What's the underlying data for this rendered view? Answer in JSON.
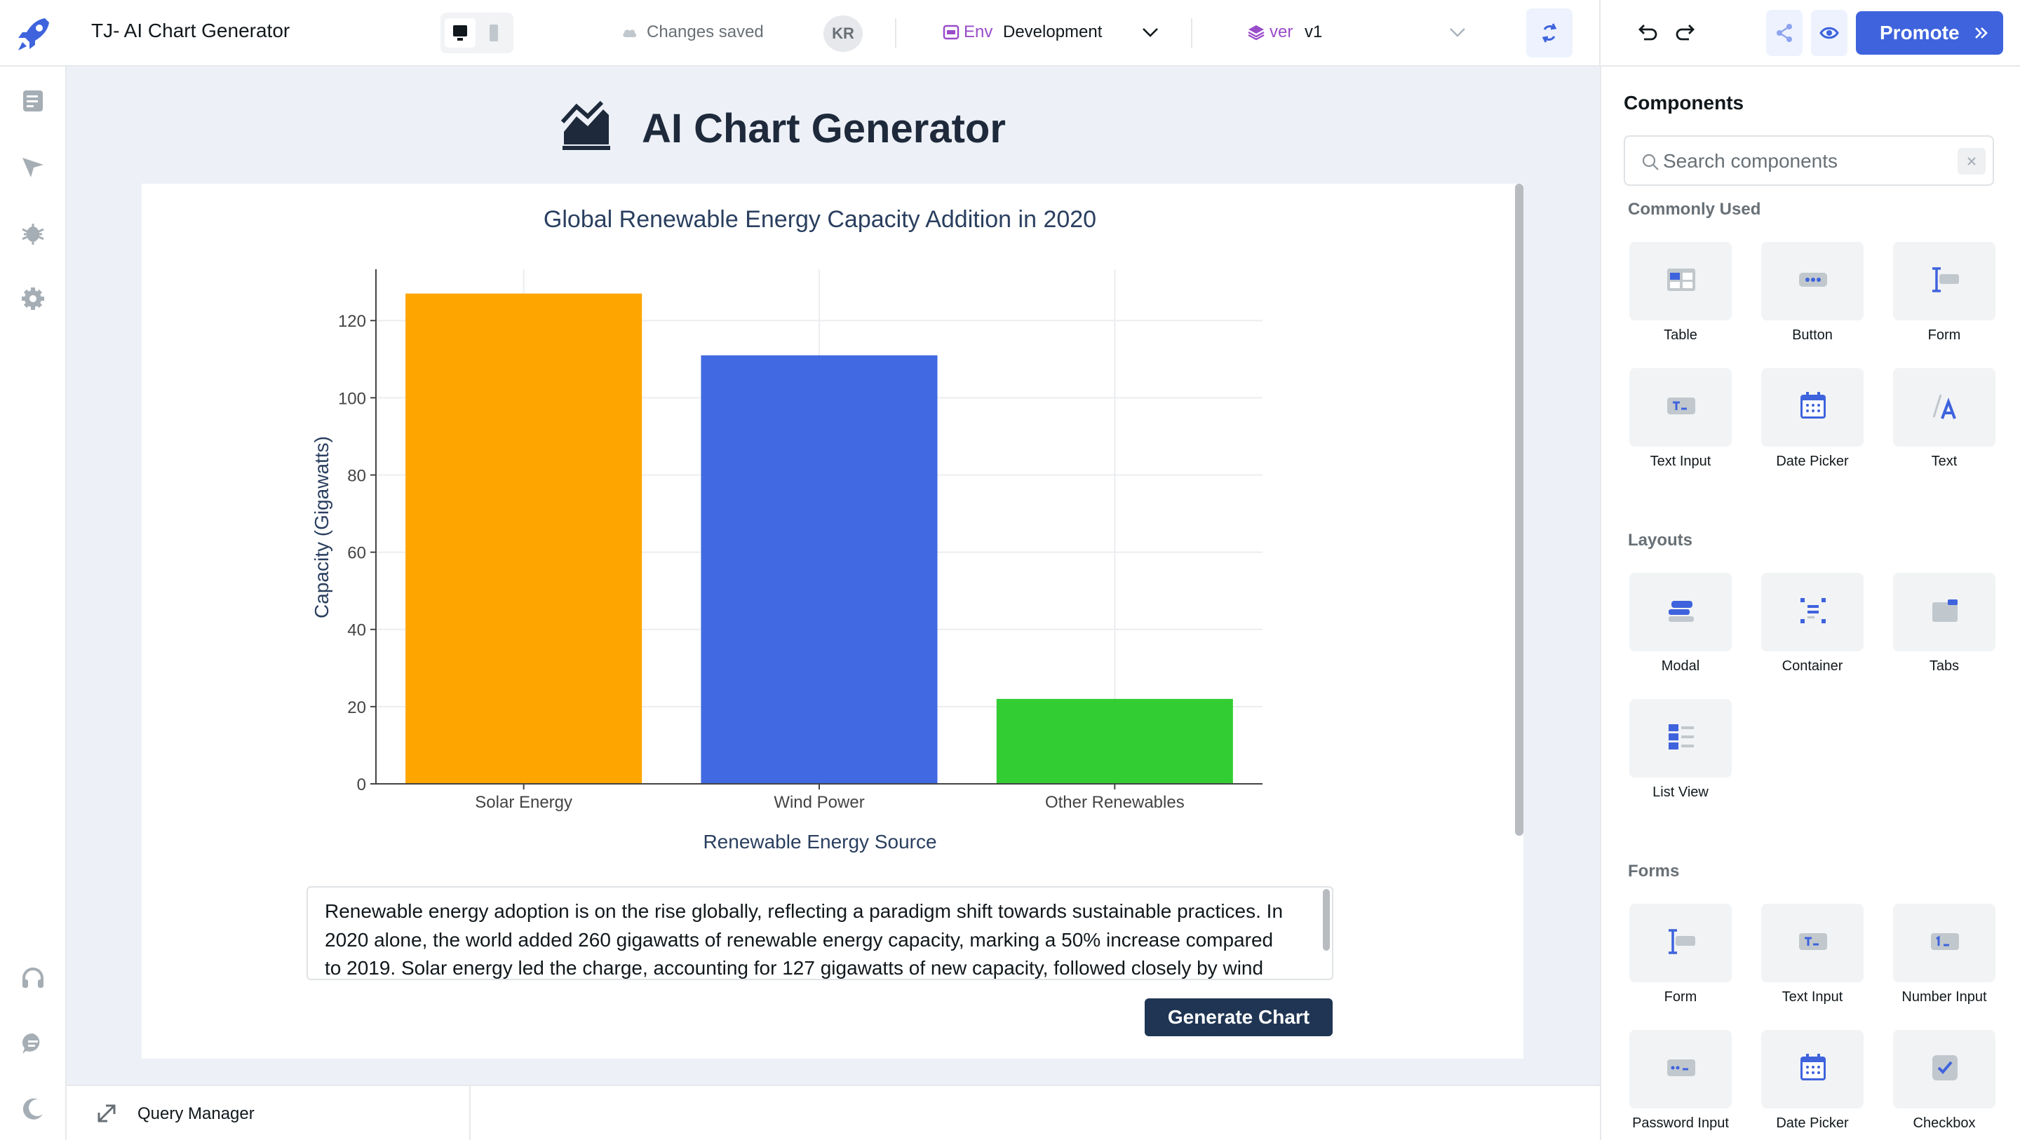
{
  "topbar": {
    "app_title": "TJ- AI Chart Generator",
    "save_status": "Changes saved",
    "avatar_initials": "KR",
    "env_label": "Env",
    "env_value": "Development",
    "version_label": "ver",
    "version_value": "v1",
    "promote_label": "Promote",
    "accent_color": "#3e63dd"
  },
  "page": {
    "title": "AI Chart Generator"
  },
  "chart_data": {
    "type": "bar",
    "title": "Global Renewable Energy Capacity Addition in 2020",
    "xlabel": "Renewable Energy Source",
    "ylabel": "Capacity (Gigawatts)",
    "categories": [
      "Solar Energy",
      "Wind Power",
      "Other Renewables"
    ],
    "values": [
      127,
      111,
      22
    ],
    "colors": [
      "#ffa500",
      "#4169e1",
      "#32cd32"
    ],
    "ylim": [
      0,
      133.3
    ],
    "yticks": [
      0,
      20,
      40,
      60,
      80,
      100,
      120
    ],
    "grid": true,
    "legend": "none"
  },
  "prompt_text": "Renewable energy adoption is on the rise globally, reflecting a paradigm shift towards sustainable practices. In 2020 alone, the world added 260 gigawatts of renewable energy capacity, marking a 50% increase compared to 2019. Solar energy led the charge, accounting for 127 gigawatts of new capacity, followed closely by wind",
  "generate_button": "Generate Chart",
  "query_manager": "Query Manager",
  "components_panel": {
    "title": "Components",
    "search_placeholder": "Search components",
    "sections": [
      {
        "title": "Commonly Used",
        "items": [
          "Table",
          "Button",
          "Form",
          "Text Input",
          "Date Picker",
          "Text"
        ]
      },
      {
        "title": "Layouts",
        "items": [
          "Modal",
          "Container",
          "Tabs",
          "List View"
        ]
      },
      {
        "title": "Forms",
        "items": [
          "Form",
          "Text Input",
          "Number Input",
          "Password Input",
          "Date Picker",
          "Checkbox"
        ]
      }
    ]
  }
}
